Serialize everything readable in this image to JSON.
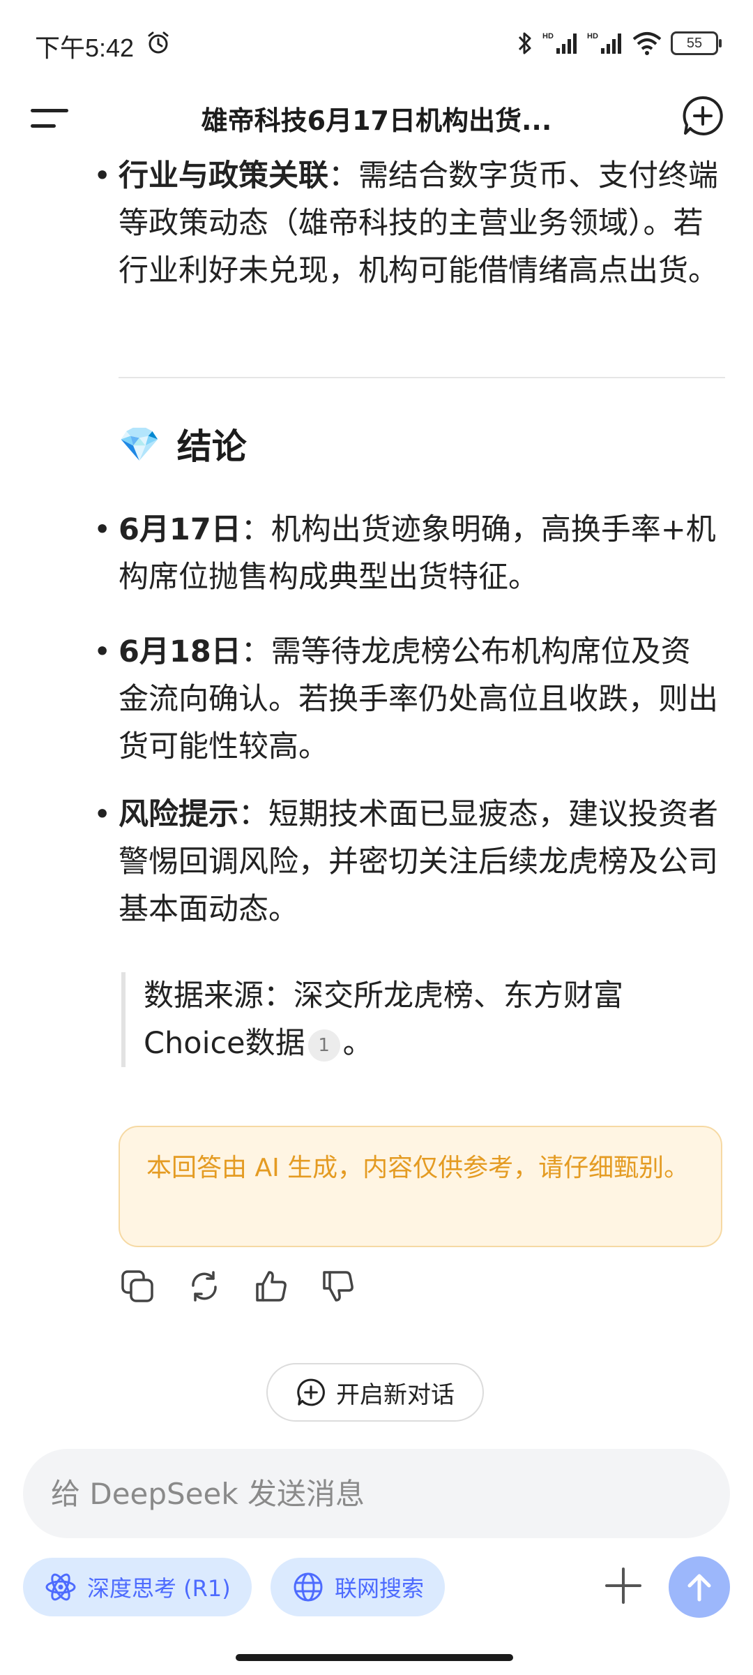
{
  "status_bar": {
    "time": "下午5:42",
    "battery": "55",
    "icons": [
      "alarm-icon",
      "bluetooth-icon",
      "signal-hd-icon",
      "signal-hd-icon",
      "wifi-icon",
      "battery-icon"
    ]
  },
  "header": {
    "title": "雄帝科技6月17日机构出货...",
    "icons": [
      "menu-icon",
      "new-chat-icon"
    ]
  },
  "content": {
    "policy_bullet": {
      "bold": "行业与政策关联",
      "text": "：需结合数字货币、支付终端等政策动态（雄帝科技的主营业务领域）。若行业利好未兑现，机构可能借情绪高点出货。"
    },
    "conclusion": {
      "emoji": "💎",
      "title": "结论",
      "items": [
        {
          "bold": "6月17日",
          "text": "：机构出货迹象明确，高换手率+机构席位抛售构成典型出货特征。"
        },
        {
          "bold": "6月18日",
          "text": "：需等待龙虎榜公布机构席位及资金流向确认。若换手率仍处高位且收跌，则出货可能性较高。"
        },
        {
          "bold": "风险提示",
          "text": "：短期技术面已显疲态，建议投资者警惕回调风险，并密切关注后续龙虎榜及公司基本面动态。"
        }
      ]
    },
    "source": {
      "text": "数据来源：深交所龙虎榜、东方财富Choice数据",
      "citation": "1",
      "end": "。"
    },
    "ai_notice": "本回答由 AI 生成，内容仅供参考，请仔细甄别。"
  },
  "actions": [
    "copy-icon",
    "regenerate-icon",
    "thumbs-up-icon",
    "thumbs-down-icon"
  ],
  "new_dialog": {
    "label": "开启新对话"
  },
  "composer": {
    "placeholder": "给 DeepSeek 发送消息",
    "value": "",
    "chip_deep_think": "深度思考 (R1)",
    "chip_search": "联网搜索"
  },
  "colors": {
    "accent": "#4d6bfe",
    "chip_bg": "#dbeafe",
    "notice_bg": "#fff5e3",
    "notice_text": "#e49b22",
    "send_btn": "#9cb7fb"
  }
}
